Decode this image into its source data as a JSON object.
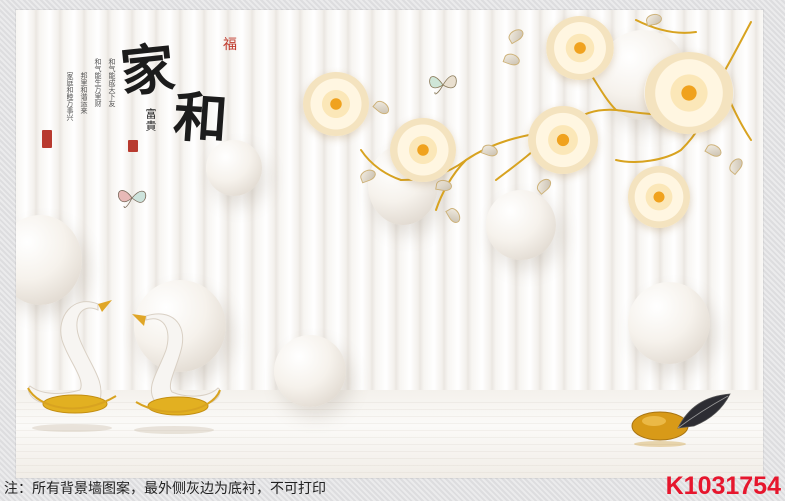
{
  "mural": {
    "title_main_1": "家",
    "title_main_2": "和",
    "title_fu": "福",
    "title_fugui": "富貴",
    "poem_lines": [
      "和气能成天下友",
      "和气能生万里财",
      "邦里和谐运来",
      "家庭和睦万事兴"
    ],
    "icons": [
      "swan-icon",
      "swan-icon",
      "butterfly-icon",
      "butterfly-icon",
      "peony-flower-icon",
      "gold-stone-icon",
      "feather-icon"
    ]
  },
  "footer": {
    "notice": "注：所有背景墙图案，最外侧灰边为底衬，不可打印",
    "code": "K1031754"
  },
  "colors": {
    "code_red": "#e6162d",
    "seal_red": "#b83a2f",
    "gold": "#d8a320"
  }
}
